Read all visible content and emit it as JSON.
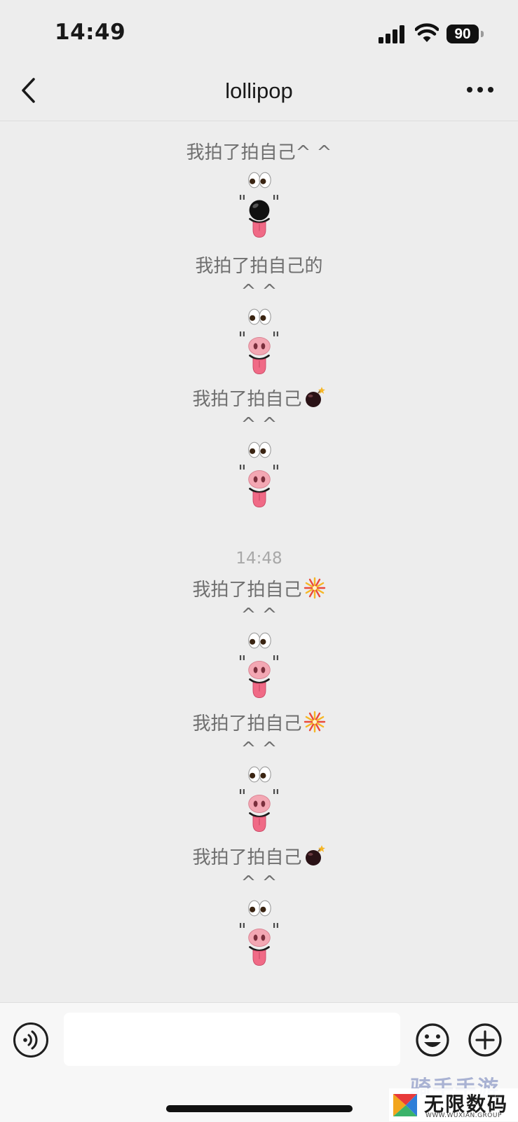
{
  "status_bar": {
    "time": "14:49",
    "battery": "90"
  },
  "nav": {
    "title": "lollipop"
  },
  "messages": [
    {
      "text": "我拍了拍自己^ ^",
      "suffix_emoji": "",
      "caret_line": "",
      "nose": "bomb"
    },
    {
      "text": "我拍了拍自己的",
      "suffix_emoji": "",
      "caret_line": "^ ^",
      "nose": "pig-nose"
    },
    {
      "text": "我拍了拍自己",
      "suffix_emoji": "bomb-icon",
      "caret_line": "^ ^",
      "nose": "pig-nose"
    },
    {
      "text": "我拍了拍自己",
      "suffix_emoji": "fireworks-icon",
      "caret_line": "^ ^",
      "nose": "pig-nose"
    },
    {
      "text": "我拍了拍自己",
      "suffix_emoji": "fireworks-icon",
      "caret_line": "^ ^",
      "nose": "pig-nose"
    },
    {
      "text": "我拍了拍自己",
      "suffix_emoji": "bomb-icon",
      "caret_line": "^ ^",
      "nose": "pig-nose"
    }
  ],
  "face": {
    "quote": "\""
  },
  "timestamp": "14:48",
  "input_bar": {
    "placeholder": ""
  },
  "watermark": {
    "back_text": "骑手手游",
    "brand": "无限数码",
    "sub": "WWW.WUXIAN.GROUP"
  },
  "icons": {
    "back": "chevron-left-icon",
    "more": "more-dots-icon",
    "voice": "voice-icon",
    "emoji": "smiley-icon",
    "plus": "plus-circle-icon"
  }
}
